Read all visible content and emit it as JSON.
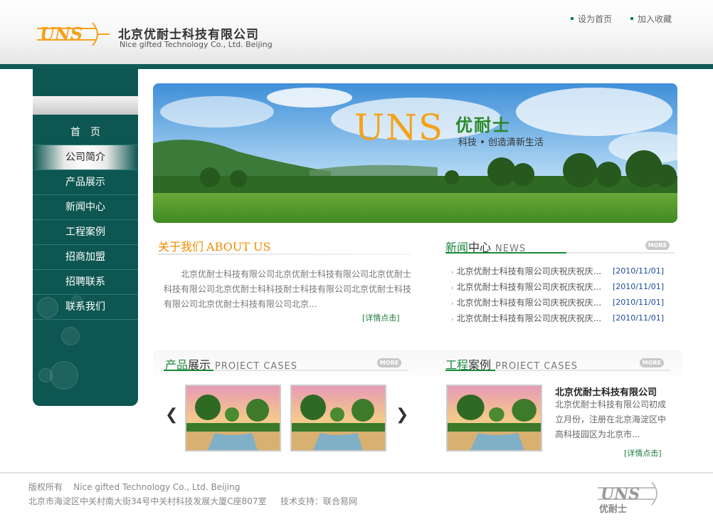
{
  "header": {
    "logo_text": "UNS",
    "company_cn": "北京优耐士科技有限公司",
    "company_en": "Nice gifted Technology Co., Ltd. Beijing",
    "links": [
      {
        "label": "设为首页"
      },
      {
        "label": "加入收藏"
      }
    ]
  },
  "sidebar": {
    "items": [
      {
        "label": "首　页"
      },
      {
        "label": "公司简介"
      },
      {
        "label": "产品展示"
      },
      {
        "label": "新闻中心"
      },
      {
        "label": "工程案例"
      },
      {
        "label": "招商加盟"
      },
      {
        "label": "招聘联系"
      },
      {
        "label": "联系我们"
      }
    ],
    "active_index": 1
  },
  "banner": {
    "logo": "UNS",
    "brand": "优耐士",
    "slogan": "科技 • 创造清新生活"
  },
  "about": {
    "title_cn": "关于我们",
    "title_en": "ABOUT US",
    "text": "北京优耐士科技有限公司北京优耐士科技有限公司北京优耐士科技有限公司北京优耐士科科技耐士科技有限公司北京优耐士科技有限公司北京优耐士科技有限公司北京...",
    "detail": "[详情点击]"
  },
  "news": {
    "title_a": "新闻",
    "title_b": "中心",
    "title_en": "NEWS",
    "more": "MORE",
    "items": [
      {
        "title": "北京优耐士科技有限公司庆祝庆祝庆...",
        "date": "[2010/11/01]"
      },
      {
        "title": "北京优耐士科技有限公司庆祝庆祝庆...",
        "date": "[2010/11/01]"
      },
      {
        "title": "北京优耐士科技有限公司庆祝庆祝庆...",
        "date": "[2010/11/01]"
      },
      {
        "title": "北京优耐士科技有限公司庆祝庆祝庆...",
        "date": "[2010/11/01]"
      }
    ]
  },
  "products": {
    "title_a": "产品",
    "title_b": "展示",
    "title_en": "PROJECT CASES",
    "more": "MORE",
    "prev": "❮",
    "next": "❯"
  },
  "cases": {
    "title_a": "工程",
    "title_b": "案例",
    "title_en": "PROJECT CASES",
    "more": "MORE",
    "company": "北京优耐士科技有限公司",
    "text": "北京优耐士科技有限公司初成立月份，注册在北京海淀区中高科技园区为北京市...",
    "detail": "[详情点击]"
  },
  "footer": {
    "copyright": "版权所有",
    "company_en": "Nice gifted Technology Co., Ltd. Beijing",
    "address": "北京市海淀区中关村南大街34号中关村科技发展大厦C座807室",
    "support": "技术支持：联合易网",
    "logo_text": "UNS",
    "logo_cn": "优耐士"
  },
  "colors": {
    "accent_green": "#0d5651",
    "orange": "#f28a00",
    "news_green": "#1a8a3a"
  }
}
